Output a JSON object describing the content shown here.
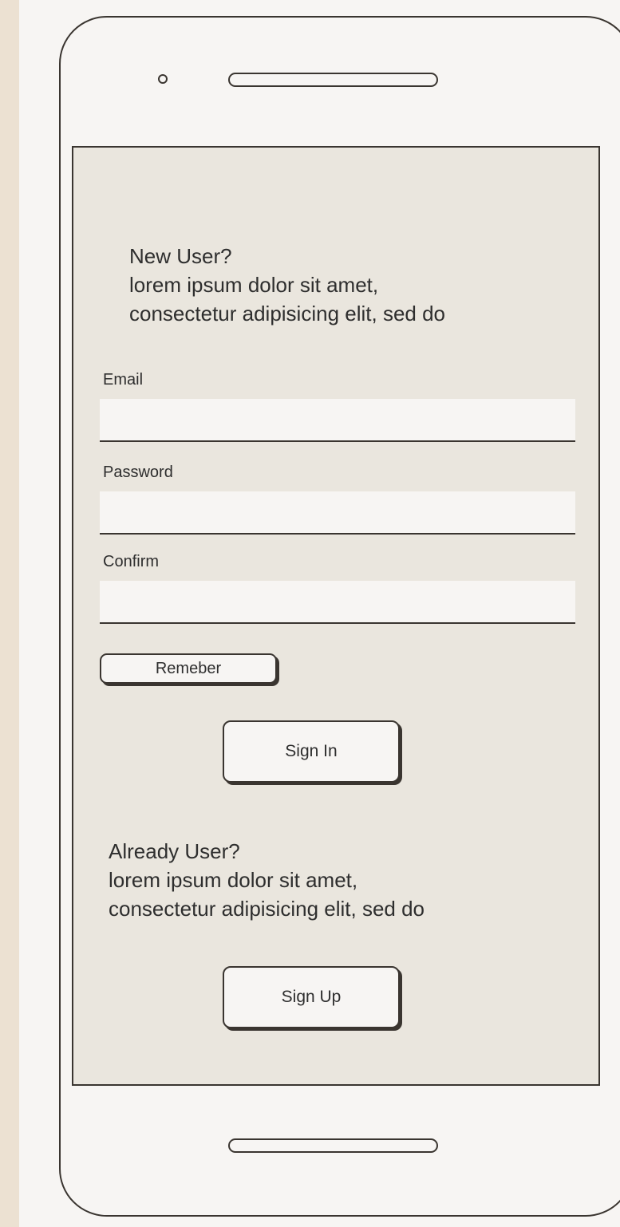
{
  "new_user": {
    "heading": "New User?",
    "line1": "lorem ipsum dolor sit amet,",
    "line2": "consectetur adipisicing elit, sed do"
  },
  "form": {
    "email_label": "Email",
    "email_value": "",
    "password_label": "Password",
    "password_value": "",
    "confirm_label": "Confirm",
    "confirm_value": "",
    "remember_label": "Remeber",
    "signin_label": "Sign In"
  },
  "existing_user": {
    "heading": "Already User?",
    "line1": "lorem ipsum dolor sit amet,",
    "line2": "consectetur adipisicing elit, sed do",
    "signup_label": "Sign Up"
  },
  "colors": {
    "page_background": "#ece1d2",
    "phone_body": "#f7f5f3",
    "screen_background": "#eae6de",
    "outline": "#3a3530"
  }
}
